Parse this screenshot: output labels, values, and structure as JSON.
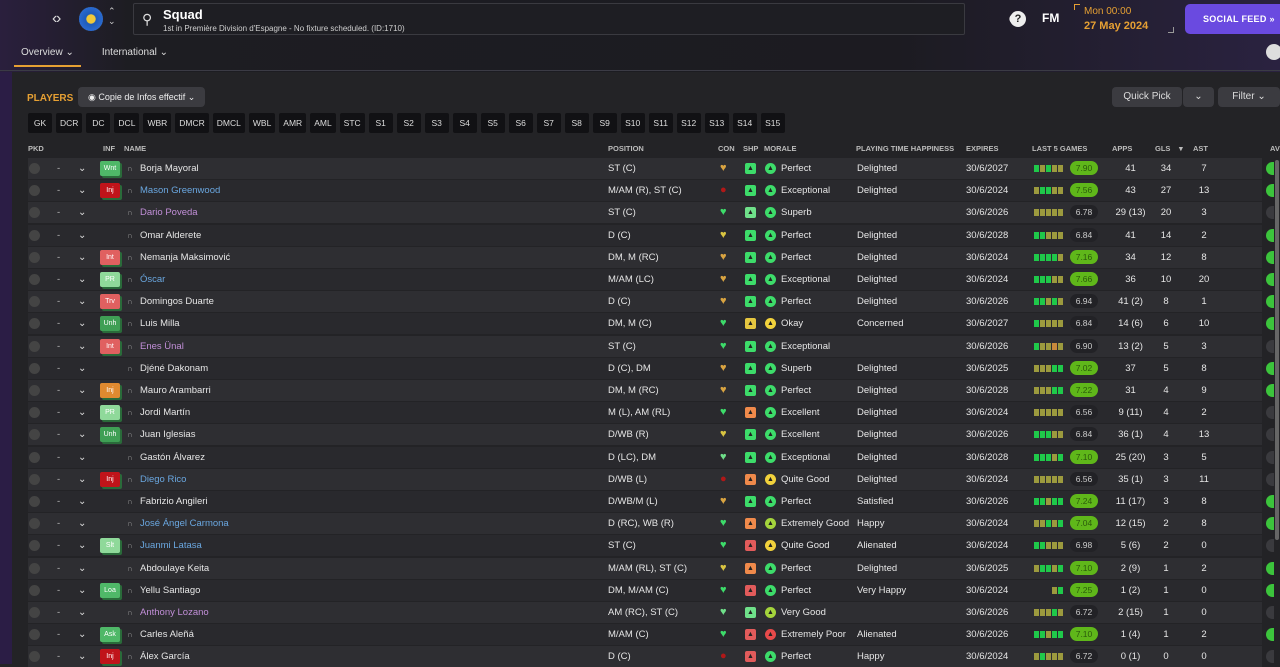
{
  "header": {
    "title": "Squad",
    "subtitle": "1st in Première Division d'Espagne - No fixture scheduled. (ID:1710)",
    "fm": "FM",
    "time": "Mon 00:00",
    "date": "27 May 2024",
    "social_feed": "SOCIAL FEED",
    "social_icon": "»"
  },
  "tabs": [
    {
      "label": "Overview ⌄"
    },
    {
      "label": "International ⌄"
    }
  ],
  "players_label": "PLAYERS",
  "view_select": "Copie de Infos effectif",
  "quick_pick": "Quick Pick",
  "filter": "Filter",
  "positions": [
    "GK",
    "DCR",
    "DC",
    "DCL",
    "WBR",
    "DMCR",
    "DMCL",
    "WBL",
    "AMR",
    "AML",
    "STC",
    "S1",
    "S2",
    "S3",
    "S4",
    "S5",
    "S6",
    "S7",
    "S8",
    "S9",
    "S10",
    "S11",
    "S12",
    "S13",
    "S14",
    "S15"
  ],
  "columns": {
    "pkd": "PKD",
    "inf": "INF",
    "name": "NAME",
    "position": "POSITION",
    "con": "CON",
    "shp": "SHP",
    "morale": "MORALE",
    "pth": "PLAYING TIME HAPPINESS",
    "expires": "EXPIRES",
    "last5": "LAST 5 GAMES",
    "apps": "APPS",
    "gls": "GLS",
    "ast": "AST",
    "av": "AV"
  },
  "colors": {
    "accent": "#e6a033",
    "social": "#6a4ae0",
    "green": "#3ddc6a",
    "rating_hi": "#5fb71a"
  },
  "rows": [
    {
      "name": "Borja Mayoral",
      "nc": "#e6e6e6",
      "inf": "Wnt",
      "ic": "#4fb868",
      "position": "ST (C)",
      "con": "#d9a441",
      "shp": "#3ddc6a",
      "mc": "#3ddc6a",
      "morale": "Perfect",
      "pth": "Delighted",
      "expires": "30/6/2027",
      "l5": "gogoo",
      "rating": "7.90",
      "hi": true,
      "apps": "41",
      "gls": "34",
      "ast": "7",
      "av": true
    },
    {
      "name": "Mason Greenwood",
      "nc": "#6aa7e0",
      "inf": "Inj",
      "ic": "#c0141a",
      "position": "M/AM (R), ST (C)",
      "con": "#b01818",
      "shp": "#3ddc6a",
      "mc": "#3ddc6a",
      "morale": "Exceptional",
      "pth": "Delighted",
      "expires": "30/6/2024",
      "l5": "oggoo",
      "rating": "7.56",
      "hi": true,
      "apps": "43",
      "gls": "27",
      "ast": "13",
      "av": true
    },
    {
      "name": "Dario Poveda",
      "nc": "#c28fd8",
      "inf": "",
      "ic": "",
      "position": "ST (C)",
      "con": "#3ddc6a",
      "shp": "#6fe08a",
      "mc": "#3ddc6a",
      "morale": "Superb",
      "pth": "",
      "expires": "30/6/2026",
      "l5": "ooooo",
      "rating": "6.78",
      "hi": false,
      "apps": "29 (13)",
      "gls": "20",
      "ast": "3",
      "av": false
    },
    {
      "name": "Omar Alderete",
      "nc": "#e6e6e6",
      "inf": "",
      "ic": "",
      "position": "D (C)",
      "con": "#d9c441",
      "shp": "#3ddc6a",
      "mc": "#3ddc6a",
      "morale": "Perfect",
      "pth": "Delighted",
      "expires": "30/6/2028",
      "l5": "ggooo",
      "rating": "6.84",
      "hi": false,
      "apps": "41",
      "gls": "14",
      "ast": "2",
      "av": true
    },
    {
      "name": "Nemanja Maksimović",
      "nc": "#e6e6e6",
      "inf": "Int",
      "ic": "#e06060",
      "position": "DM, M (RC)",
      "con": "#d9a441",
      "shp": "#3ddc6a",
      "mc": "#3ddc6a",
      "morale": "Perfect",
      "pth": "Delighted",
      "expires": "30/6/2024",
      "l5": "ggggo",
      "rating": "7.16",
      "hi": true,
      "apps": "34",
      "gls": "12",
      "ast": "8",
      "av": true
    },
    {
      "name": "Óscar",
      "nc": "#6aa7e0",
      "inf": "PR",
      "ic": "#8fd99a",
      "position": "M/AM (LC)",
      "con": "#d9a441",
      "shp": "#3ddc6a",
      "mc": "#3ddc6a",
      "morale": "Exceptional",
      "pth": "Delighted",
      "expires": "30/6/2024",
      "l5": "gggoo",
      "rating": "7.66",
      "hi": true,
      "apps": "36",
      "gls": "10",
      "ast": "20",
      "av": true
    },
    {
      "name": "Domingos Duarte",
      "nc": "#e6e6e6",
      "inf": "Trv",
      "ic": "#e06060",
      "position": "D (C)",
      "con": "#d9a441",
      "shp": "#3ddc6a",
      "mc": "#3ddc6a",
      "morale": "Perfect",
      "pth": "Delighted",
      "expires": "30/6/2026",
      "l5": "ggogo",
      "rating": "6.94",
      "hi": false,
      "apps": "41 (2)",
      "gls": "8",
      "ast": "1",
      "av": true
    },
    {
      "name": "Luis Milla",
      "nc": "#e6e6e6",
      "inf": "Unh",
      "ic": "#3f9f55",
      "position": "DM, M (C)",
      "con": "#3ddc6a",
      "shp": "#e5c640",
      "mc": "#f2d23c",
      "morale": "Okay",
      "pth": "Concerned",
      "expires": "30/6/2027",
      "l5": "goooo",
      "rating": "6.84",
      "hi": false,
      "apps": "14 (6)",
      "gls": "6",
      "ast": "10",
      "av": true
    },
    {
      "name": "Enes Ünal",
      "nc": "#c28fd8",
      "inf": "Int",
      "ic": "#e06060",
      "position": "ST (C)",
      "con": "#3ddc6a",
      "shp": "#3ddc6a",
      "mc": "#3ddc6a",
      "morale": "Exceptional",
      "pth": "",
      "expires": "30/6/2026",
      "l5": "gooro",
      "rating": "6.90",
      "hi": false,
      "apps": "13 (2)",
      "gls": "5",
      "ast": "3",
      "av": false
    },
    {
      "name": "Djéné Dakonam",
      "nc": "#e6e6e6",
      "inf": "",
      "ic": "",
      "position": "D (C), DM",
      "con": "#d9a441",
      "shp": "#3ddc6a",
      "mc": "#3ddc6a",
      "morale": "Superb",
      "pth": "Delighted",
      "expires": "30/6/2025",
      "l5": "ooogg",
      "rating": "7.02",
      "hi": true,
      "apps": "37",
      "gls": "5",
      "ast": "8",
      "av": true
    },
    {
      "name": "Mauro Arambarri",
      "nc": "#e6e6e6",
      "inf": "Inj",
      "ic": "#e08a30",
      "position": "DM, M (RC)",
      "con": "#d9a441",
      "shp": "#3ddc6a",
      "mc": "#3ddc6a",
      "morale": "Perfect",
      "pth": "Delighted",
      "expires": "30/6/2028",
      "l5": "ooogg",
      "rating": "7.22",
      "hi": true,
      "apps": "31",
      "gls": "4",
      "ast": "9",
      "av": true
    },
    {
      "name": "Jordi Martín",
      "nc": "#e6e6e6",
      "inf": "PR",
      "ic": "#8fd99a",
      "position": "M (L), AM (RL)",
      "con": "#3ddc6a",
      "shp": "#f08a4b",
      "mc": "#3ddc6a",
      "morale": "Excellent",
      "pth": "Delighted",
      "expires": "30/6/2024",
      "l5": "ooooo",
      "rating": "6.56",
      "hi": false,
      "apps": "9 (11)",
      "gls": "4",
      "ast": "2",
      "av": false
    },
    {
      "name": "Juan Iglesias",
      "nc": "#e6e6e6",
      "inf": "Unh",
      "ic": "#3f9f55",
      "position": "D/WB (R)",
      "con": "#d9c441",
      "shp": "#3ddc6a",
      "mc": "#3ddc6a",
      "morale": "Excellent",
      "pth": "Delighted",
      "expires": "30/6/2026",
      "l5": "gggoo",
      "rating": "6.84",
      "hi": false,
      "apps": "36 (1)",
      "gls": "4",
      "ast": "13",
      "av": false
    },
    {
      "name": "Gastón Álvarez",
      "nc": "#e6e6e6",
      "inf": "",
      "ic": "",
      "position": "D (LC), DM",
      "con": "#6fe08a",
      "shp": "#3ddc6a",
      "mc": "#3ddc6a",
      "morale": "Exceptional",
      "pth": "Delighted",
      "expires": "30/6/2028",
      "l5": "gggog",
      "rating": "7.10",
      "hi": true,
      "apps": "25 (20)",
      "gls": "3",
      "ast": "5",
      "av": false
    },
    {
      "name": "Diego Rico",
      "nc": "#6aa7e0",
      "inf": "Inj",
      "ic": "#c0141a",
      "position": "D/WB (L)",
      "con": "#b01818",
      "shp": "#f08a4b",
      "mc": "#f2d23c",
      "morale": "Quite Good",
      "pth": "Delighted",
      "expires": "30/6/2024",
      "l5": "ooooo",
      "rating": "6.56",
      "hi": false,
      "apps": "35 (1)",
      "gls": "3",
      "ast": "11",
      "av": false
    },
    {
      "name": "Fabrizio Angileri",
      "nc": "#e6e6e6",
      "inf": "",
      "ic": "",
      "position": "D/WB/M (L)",
      "con": "#d9a441",
      "shp": "#3ddc6a",
      "mc": "#3ddc6a",
      "morale": "Perfect",
      "pth": "Satisfied",
      "expires": "30/6/2026",
      "l5": "ggogg",
      "rating": "7.24",
      "hi": true,
      "apps": "11 (17)",
      "gls": "3",
      "ast": "8",
      "av": true
    },
    {
      "name": "José Ángel Carmona",
      "nc": "#6aa7e0",
      "inf": "",
      "ic": "",
      "position": "D (RC), WB (R)",
      "con": "#3ddc6a",
      "shp": "#f08a4b",
      "mc": "#a4d43c",
      "morale": "Extremely Good",
      "pth": "Happy",
      "expires": "30/6/2024",
      "l5": "oogog",
      "rating": "7.04",
      "hi": true,
      "apps": "12 (15)",
      "gls": "2",
      "ast": "8",
      "av": true
    },
    {
      "name": "Juanmi Latasa",
      "nc": "#6aa7e0",
      "inf": "Slt",
      "ic": "#8fd99a",
      "position": "ST (C)",
      "con": "#3ddc6a",
      "shp": "#e25b5b",
      "mc": "#f2d23c",
      "morale": "Quite Good",
      "pth": "Alienated",
      "expires": "30/6/2024",
      "l5": "ggooo",
      "rating": "6.98",
      "hi": false,
      "apps": "5 (6)",
      "gls": "2",
      "ast": "0",
      "av": false
    },
    {
      "name": "Abdoulaye Keita",
      "nc": "#e6e6e6",
      "inf": "",
      "ic": "",
      "position": "M/AM (RL), ST (C)",
      "con": "#d9c441",
      "shp": "#f08a4b",
      "mc": "#3ddc6a",
      "morale": "Perfect",
      "pth": "Delighted",
      "expires": "30/6/2025",
      "l5": "oggog",
      "rating": "7.10",
      "hi": true,
      "apps": "2 (9)",
      "gls": "1",
      "ast": "2",
      "av": true
    },
    {
      "name": "Yellu Santiago",
      "nc": "#e6e6e6",
      "inf": "Loa",
      "ic": "#4fb868",
      "position": "DM, M/AM (C)",
      "con": "#3ddc6a",
      "shp": "#e25b5b",
      "mc": "#3ddc6a",
      "morale": "Perfect",
      "pth": "Very Happy",
      "expires": "30/6/2024",
      "l5": "   og",
      "rating": "7.25",
      "hi": true,
      "apps": "1 (2)",
      "gls": "1",
      "ast": "0",
      "av": true
    },
    {
      "name": "Anthony Lozano",
      "nc": "#c28fd8",
      "inf": "",
      "ic": "",
      "position": "AM (RC), ST (C)",
      "con": "#6fe08a",
      "shp": "#6fe08a",
      "mc": "#a4d43c",
      "morale": "Very Good",
      "pth": "",
      "expires": "30/6/2026",
      "l5": "ooogo",
      "rating": "6.72",
      "hi": false,
      "apps": "2 (15)",
      "gls": "1",
      "ast": "0",
      "av": false
    },
    {
      "name": "Carles Aleñá",
      "nc": "#e6e6e6",
      "inf": "Ask",
      "ic": "#4fb868",
      "position": "M/AM (C)",
      "con": "#3ddc6a",
      "shp": "#e25b5b",
      "mc": "#e84a4a",
      "morale": "Extremely Poor",
      "pth": "Alienated",
      "expires": "30/6/2026",
      "l5": "ggogg",
      "rating": "7.10",
      "hi": true,
      "apps": "1 (4)",
      "gls": "1",
      "ast": "2",
      "av": true
    },
    {
      "name": "Álex García",
      "nc": "#e6e6e6",
      "inf": "Inj",
      "ic": "#c0141a",
      "position": "D (C)",
      "con": "#b01818",
      "shp": "#e25b5b",
      "mc": "#3ddc6a",
      "morale": "Perfect",
      "pth": "Happy",
      "expires": "30/6/2024",
      "l5": "ogooo",
      "rating": "6.72",
      "hi": false,
      "apps": "0 (1)",
      "gls": "0",
      "ast": "0",
      "av": false
    }
  ]
}
